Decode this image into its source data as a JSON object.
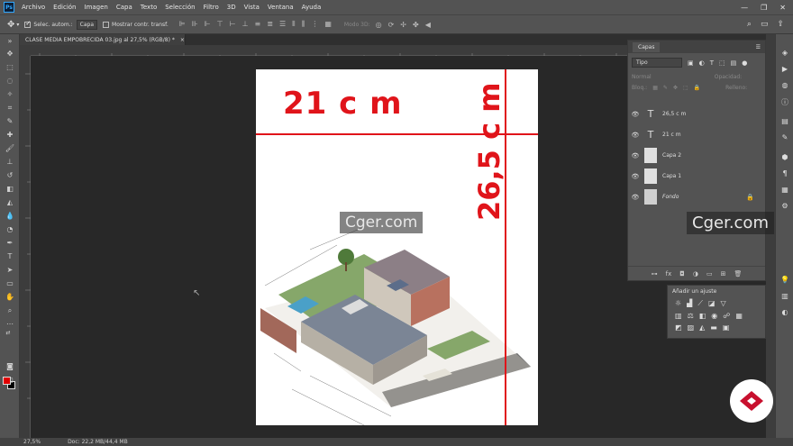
{
  "menubar": {
    "items": [
      "Archivo",
      "Edición",
      "Imagen",
      "Capa",
      "Texto",
      "Selección",
      "Filtro",
      "3D",
      "Vista",
      "Ventana",
      "Ayuda"
    ]
  },
  "options": {
    "auto_select_label": "Selec. autom.:",
    "auto_select_value": "Capa",
    "transform_label": "Mostrar contr. transf.",
    "mode3d_label": "Modo 3D:"
  },
  "document": {
    "tab_title": "CLASE MEDIA EMPOBRECIDA 03.jpg al 27,5% (RGB/8) *",
    "width_label": "21 c m",
    "height_label": "26,5 c m"
  },
  "watermark": {
    "text1": "Cger.com",
    "text2": "Cger.com"
  },
  "layers": {
    "tab": "Capas",
    "filter_value": "Tipo",
    "blend_mode": "Normal",
    "opacity_label": "Opacidad:",
    "lock_label": "Bloq.:",
    "fill_label": "Relleno:",
    "items": [
      {
        "name": "26,5 c m",
        "type": "text"
      },
      {
        "name": "21 c m",
        "type": "text"
      },
      {
        "name": "Capa 2",
        "type": "white"
      },
      {
        "name": "Capa 1",
        "type": "white"
      },
      {
        "name": "Fondo",
        "type": "image"
      }
    ]
  },
  "adjustments": {
    "title": "Añadir un ajuste"
  },
  "status": {
    "zoom": "27,5%",
    "doc_info": "Doc: 22,2 MB/44,4 MB"
  },
  "colors": {
    "foreground": "#e00000",
    "background": "#000000",
    "accent_red": "#e0141a"
  }
}
